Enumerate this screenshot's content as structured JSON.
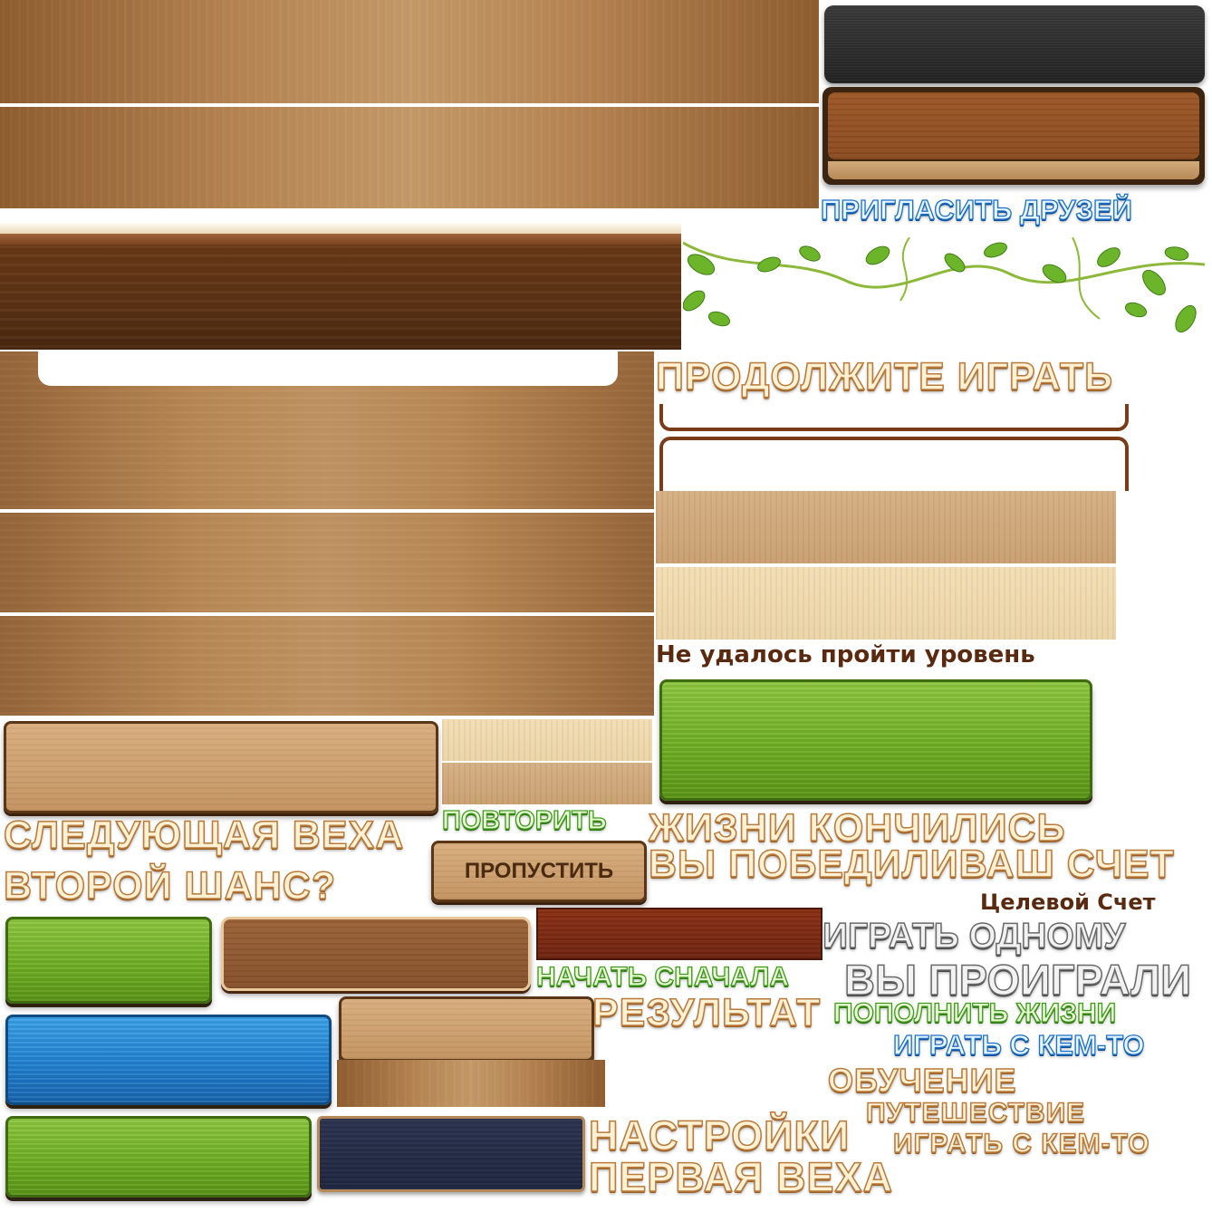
{
  "labels": {
    "invite_friends": "ПРИГЛАСИТЬ ДРУЗЕЙ",
    "continue_playing": "ПРОДОЛЖИТЕ ИГРАТЬ",
    "level_failed": "Не удалось пройти уровень",
    "next_milestone": "СЛЕДУЮЩАЯ ВЕХА",
    "repeat": "ПОВТОРИТЬ",
    "lives_over": "ЖИЗНИ КОНЧИЛИСЬ",
    "skip": "ПРОПУСТИТЬ",
    "second_chance": "ВТОРОЙ ШАНС?",
    "you_won_your_score": "ВЫ ПОБЕДИЛИВАШ СЧЕТ",
    "target_score": "Целевой Счет",
    "play_solo": "ИГРАТЬ ОДНОМУ",
    "restart": "НАЧАТЬ СНАЧАЛА",
    "you_lost": "ВЫ ПРОИГРАЛИ",
    "result": "РЕЗУЛЬТАТ",
    "refill_lives": "ПОПОЛНИТЬ ЖИЗНИ",
    "play_with_someone_blue": "ИГРАТЬ С КЕМ-ТО",
    "tutorial": "ОБУЧЕНИЕ",
    "journey": "ПУТЕШЕСТВИЕ",
    "play_with_someone_wood": "ИГРАТЬ С КЕМ-ТО",
    "settings": "НАСТРОЙКИ",
    "first_milestone": "ПЕРВАЯ ВЕХА"
  },
  "colors": {
    "wood_text_outline": "#b97a3a",
    "green_text_outline": "#3e9a1a",
    "blue_text_outline": "#1d70c8",
    "dark_label": "#5a2a10"
  },
  "decor": {
    "vines": "vine-leaves-icon"
  }
}
